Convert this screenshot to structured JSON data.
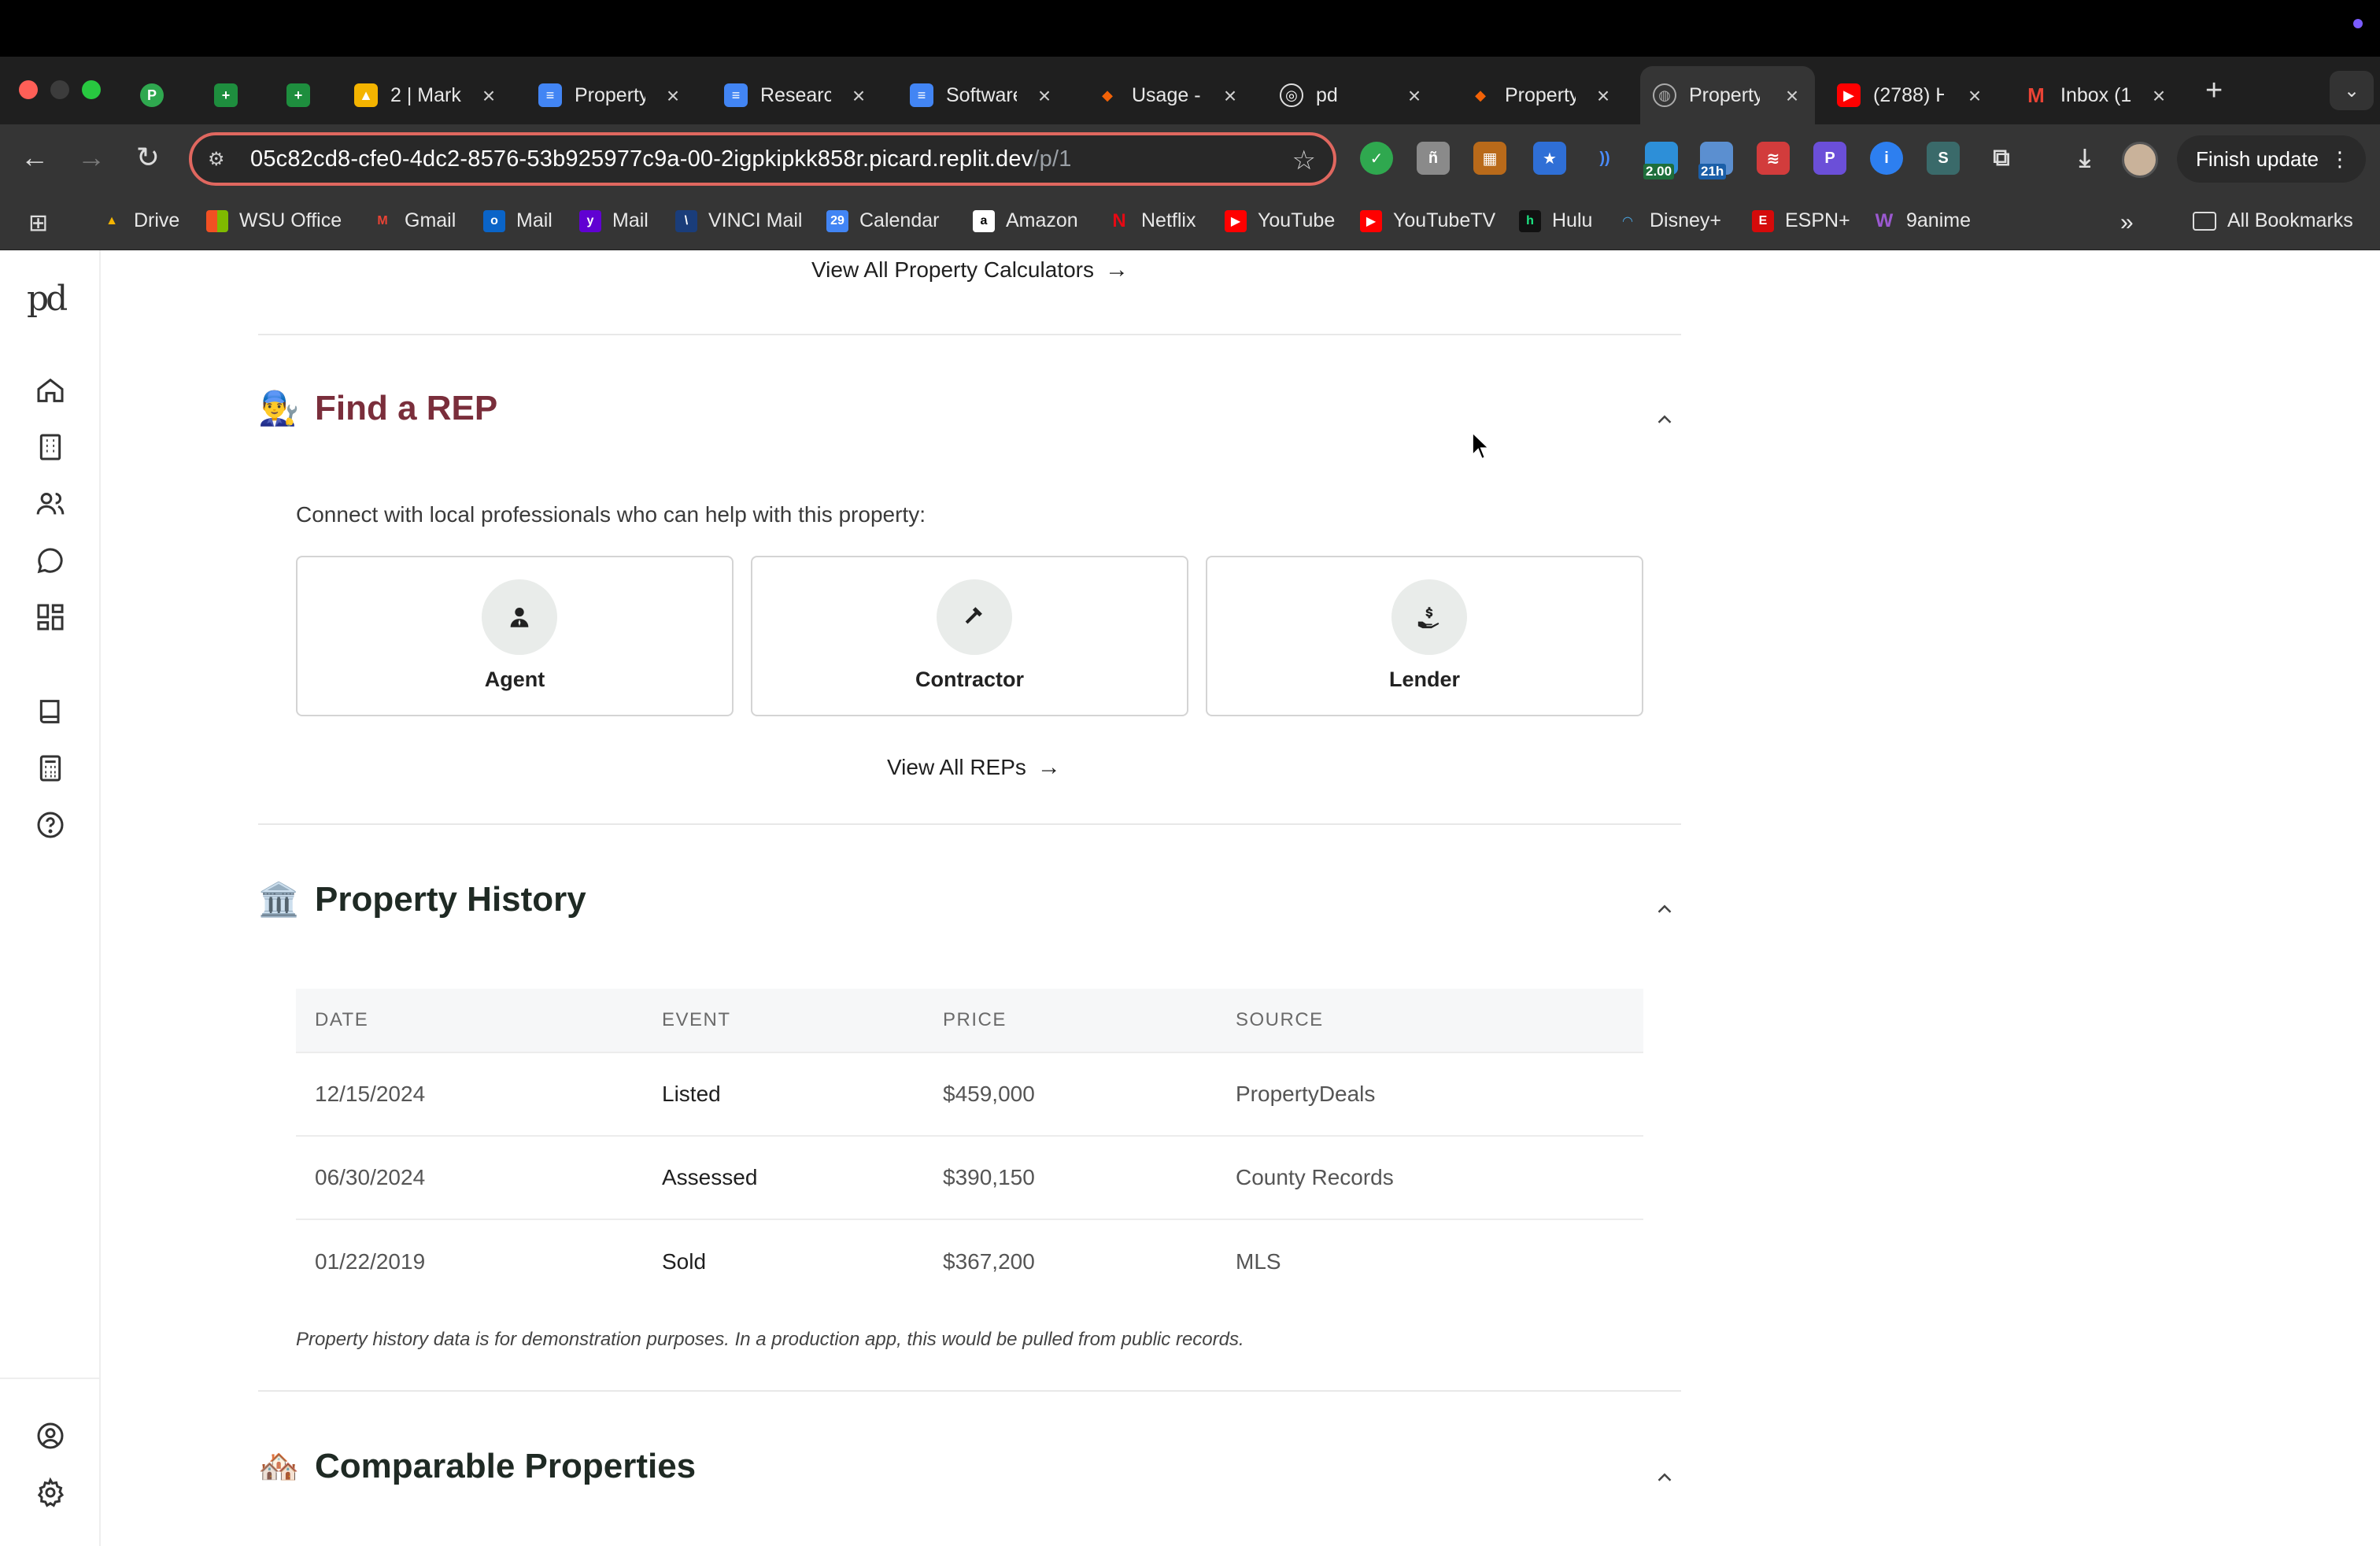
{
  "browser": {
    "tabs": [
      {
        "title": "",
        "favicon": "P",
        "color": "#2fa84f"
      },
      {
        "title": "",
        "favicon": "+",
        "color": "#1e8e3e"
      },
      {
        "title": "",
        "favicon": "+",
        "color": "#1e8e3e"
      },
      {
        "title": "2 | Mark",
        "favicon": "drive-icon",
        "color": "#f4b400"
      },
      {
        "title": "Property",
        "favicon": "doc-icon",
        "color": "#4285f4"
      },
      {
        "title": "Researc",
        "favicon": "doc-icon",
        "color": "#4285f4"
      },
      {
        "title": "Software",
        "favicon": "doc-icon",
        "color": "#4285f4"
      },
      {
        "title": "Usage -",
        "favicon": "replit-icon",
        "color": "#f26207"
      },
      {
        "title": "pd",
        "favicon": "openai-icon",
        "color": "#222222"
      },
      {
        "title": "Property",
        "favicon": "replit-icon",
        "color": "#f26207"
      },
      {
        "title": "Property",
        "favicon": "globe-icon",
        "color": "#888888"
      },
      {
        "title": "(2788) H",
        "favicon": "youtube-icon",
        "color": "#ff0000"
      },
      {
        "title": "Inbox (1",
        "favicon": "gmail-icon",
        "color": "#ea4335"
      }
    ],
    "url_host": "05c82cd8-cfe0-4dc2-8576-53b925977c9a-00-2igpkipkk858r.picard.replit.dev",
    "url_path": "/p/1",
    "extensions_badges": [
      "2.00",
      "21h"
    ],
    "finish_update": "Finish update",
    "bookmarks": [
      "Drive",
      "WSU Office",
      "Gmail",
      "Mail",
      "Mail",
      "VINCI Mail",
      "Calendar",
      "Amazon",
      "Netflix",
      "YouTube",
      "YouTubeTV",
      "Hulu",
      "Disney+",
      "ESPN+",
      "9anime"
    ],
    "all_bookmarks": "All Bookmarks"
  },
  "app": {
    "logo": "pd",
    "calculators_link": "View All Property Calculators",
    "find_rep": {
      "emoji": "👨‍🔧",
      "title": "Find a REP",
      "intro": "Connect with local professionals who can help with this property:",
      "cards": [
        "Agent",
        "Contractor",
        "Lender"
      ],
      "view_all": "View All REPs"
    },
    "history": {
      "emoji": "🏛️",
      "title": "Property History",
      "columns": [
        "DATE",
        "EVENT",
        "PRICE",
        "SOURCE"
      ],
      "rows": [
        [
          "12/15/2024",
          "Listed",
          "$459,000",
          "PropertyDeals"
        ],
        [
          "06/30/2024",
          "Assessed",
          "$390,150",
          "County Records"
        ],
        [
          "01/22/2019",
          "Sold",
          "$367,200",
          "MLS"
        ]
      ],
      "note": "Property history data is for demonstration purposes. In a production app, this would be pulled from public records."
    },
    "comparables": {
      "emoji": "🏘️",
      "title": "Comparable Properties"
    },
    "colors": {
      "rep_title": "#7a2e3b",
      "heading": "#222222"
    }
  }
}
